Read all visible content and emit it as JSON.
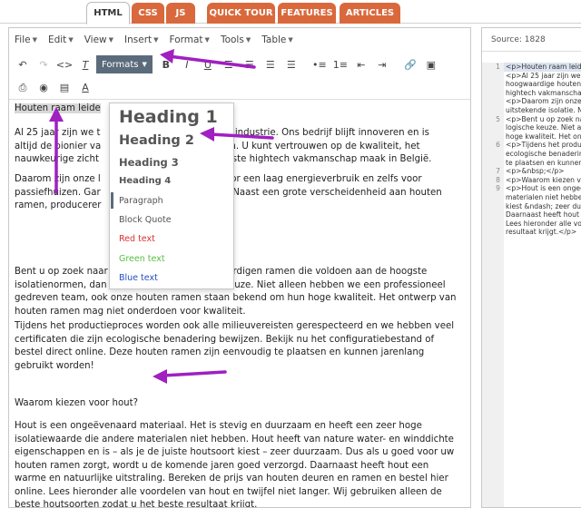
{
  "tabs": [
    "HTML",
    "CSS",
    "JS",
    "QUICK TOUR",
    "FEATURES",
    "ARTICLES"
  ],
  "menu": [
    "File",
    "Edit",
    "View",
    "Insert",
    "Format",
    "Tools",
    "Table"
  ],
  "toolbar": {
    "formats_label": "Formats"
  },
  "formats_menu": {
    "heading1": "Heading 1",
    "heading2": "Heading 2",
    "heading3": "Heading 3",
    "heading4": "Heading 4",
    "paragraph": "Paragraph",
    "blockquote": "Block Quote",
    "red": "Red text",
    "green": "Green text",
    "blue": "Blue text"
  },
  "content": {
    "title": "Houten raam leide",
    "p1a": "Al 25 jaar zijn we t",
    "p1a_tail": "n raamindustrie. Ons bedrijf blijft innoveren en is",
    "p1b": "altijd de pionier va",
    "p1b_tail": "men. U kunt vertrouwen op de kwaliteit, het",
    "p1c": "nauwkeurige zicht",
    "p1c_tail": "uwste hightech vakmanschap maak in België.",
    "p2a": "Daarom zijn onze l",
    "p2a_tail": "t voor een laag energieverbruik en zelfs voor",
    "p2b": "passiefhuizen. Gar",
    "p2b_tail": "tie. Naast een grote verscheidenheid aan houten",
    "p2c": "ramen, producerer",
    "p3": "Bent u op zoek naar houten ramen? Wij vervaardigen ramen die voldoen aan de hoogste isolatienormen, dan is ons bedrijf een goede keuze. Niet alleen hebben we een professioneel gedreven team, ook onze houten ramen staan bekend om hun hoge kwaliteit. Het ontwerp van houten ramen mag niet onderdoen voor kwaliteit.",
    "p4": "Tijdens het productieproces worden ook alle milieuvereisten gerespecteerd en we hebben veel certificaten die zijn ecologische benadering bewijzen. Bekijk nu het configuratiebestand of bestel direct online. Deze houten ramen zijn eenvoudig te plaatsen en kunnen jarenlang gebruikt worden!",
    "h_why": "Waarom kiezen voor hout?",
    "p5": "Hout is een ongeëvenaard materiaal. Het is stevig en duurzaam en heeft een zeer hoge isolatiewaarde die andere materialen niet hebben. Hout heeft van nature water- en winddichte eigenschappen en is – als je de juiste houtsoort kiest – zeer duurzaam. Dus als u goed voor uw houten ramen zorgt, wordt u de komende jaren goed verzorgd. Daarnaast heeft hout een warme en natuurlijke uitstraling. Bereken de prijs van houten deuren en ramen en bestel hier online. Lees hieronder alle voordelen van hout en twijfel niet langer. Wij gebruiken alleen de beste houtsoorten zodat u het beste resultaat krijgt."
  },
  "source": {
    "header": "Source: 1828",
    "lines": [
      [
        "1",
        "<p>Houten raam leide"
      ],
      [
        "",
        "<p>Al 25 jaar zijn we"
      ],
      [
        "",
        "hoogwaardige houten"
      ],
      [
        "",
        "hightech vakmanschap"
      ],
      [
        "",
        "<p>Daarom zijn onze"
      ],
      [
        "",
        "uitstekende isolatie. N"
      ],
      [
        "5",
        "<p>Bent u op zoek na"
      ],
      [
        "",
        "logische keuze. Niet a"
      ],
      [
        "",
        "hoge kwaliteit. Het on"
      ],
      [
        "6",
        "<p>Tijdens het produc"
      ],
      [
        "",
        "ecologische benaderin"
      ],
      [
        "",
        "te plaatsen en kunnen"
      ],
      [
        "7",
        "<p>&nbsp;</p>"
      ],
      [
        "8",
        "<p>Waarom kiezen vo"
      ],
      [
        "9",
        "<p>Hout is een ongeê"
      ],
      [
        "",
        "materialen niet hebbe"
      ],
      [
        "",
        "kiest &ndash; zeer du"
      ],
      [
        "",
        "Daarnaast heeft hout"
      ],
      [
        "",
        "Lees hieronder alle vo"
      ],
      [
        "",
        "resultaat krijgt.</p>"
      ]
    ]
  },
  "colors": {
    "tab_orange": "#d9693c",
    "formats_bg": "#5b6b7b",
    "arrow": "#a020c0"
  }
}
